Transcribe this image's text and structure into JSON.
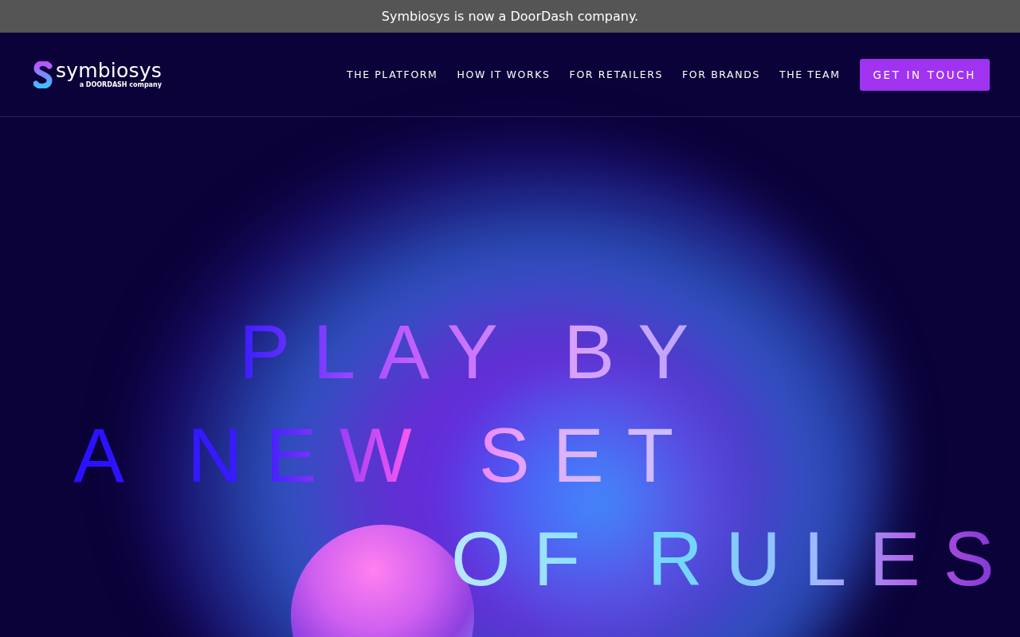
{
  "announcement": "Symbiosys is now a DoorDash company.",
  "logo": {
    "name": "symbiosys",
    "tagline": "a DOORDASH company"
  },
  "nav": [
    {
      "label": "THE PLATFORM"
    },
    {
      "label": "HOW IT WORKS"
    },
    {
      "label": "FOR RETAILERS"
    },
    {
      "label": "FOR BRANDS"
    },
    {
      "label": "THE TEAM"
    }
  ],
  "cta": "GET IN TOUCH",
  "headline": [
    "PLAY BY",
    "A NEW SET",
    "OF RULES"
  ]
}
